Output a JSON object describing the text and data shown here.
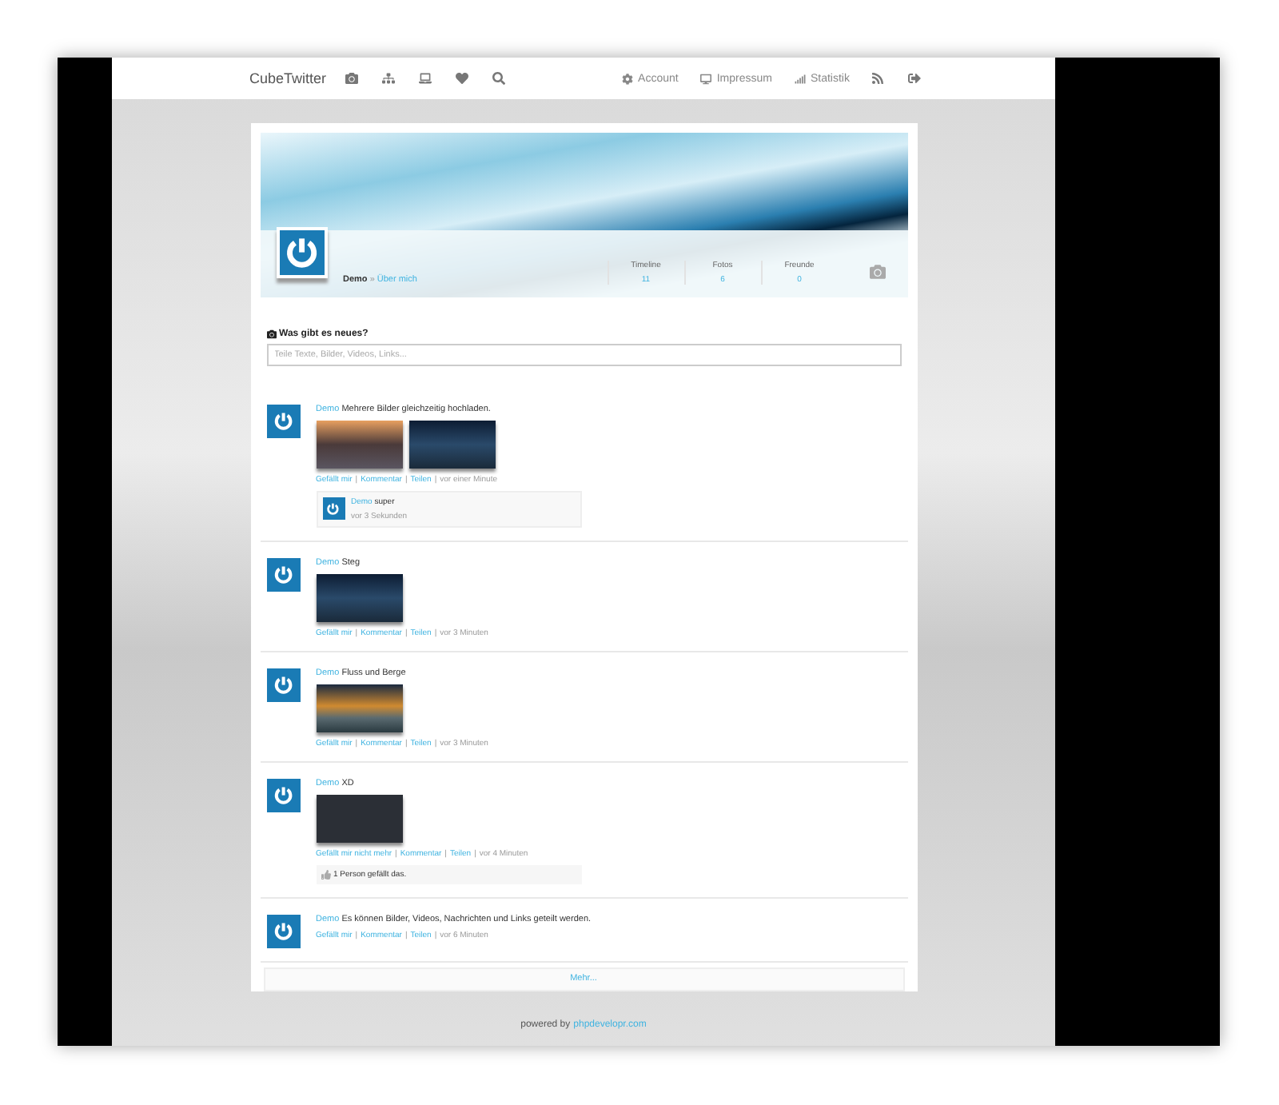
{
  "navbar": {
    "brand": "CubeTwitter",
    "links": [
      {
        "label": "Account"
      },
      {
        "label": "Impressum"
      },
      {
        "label": "Statistik"
      }
    ]
  },
  "profile": {
    "name": "Demo",
    "separator": "»",
    "about_link": "Über mich",
    "stats": [
      {
        "label": "Timeline",
        "value": "11"
      },
      {
        "label": "Fotos",
        "value": "6"
      },
      {
        "label": "Freunde",
        "value": "0"
      }
    ]
  },
  "composer": {
    "title": "Was gibt es neues?",
    "placeholder": "Teile Texte, Bilder, Videos, Links..."
  },
  "posts": [
    {
      "author": "Demo",
      "text": "Mehrere Bilder gleichzeitig hochladen.",
      "images": [
        {
          "kind": "road"
        },
        {
          "kind": "pier"
        }
      ],
      "actions": [
        "Gefällt mir",
        "|",
        "Kommentar",
        "|",
        "Teilen",
        "|"
      ],
      "time": "vor einer Minute",
      "comment": {
        "author": "Demo",
        "text": "super",
        "time": "vor 3 Sekunden"
      }
    },
    {
      "author": "Demo",
      "text": "Steg",
      "images": [
        {
          "kind": "pier"
        }
      ],
      "actions": [
        "Gefällt mir",
        "|",
        "Kommentar",
        "|",
        "Teilen",
        "|"
      ],
      "time": "vor 3 Minuten"
    },
    {
      "author": "Demo",
      "text": "Fluss und Berge",
      "images": [
        {
          "kind": "mountains"
        }
      ],
      "actions": [
        "Gefällt mir",
        "|",
        "Kommentar",
        "|",
        "Teilen",
        "|"
      ],
      "time": "vor 3 Minuten"
    },
    {
      "author": "Demo",
      "text": "XD",
      "images": [
        {
          "kind": "code"
        }
      ],
      "actions": [
        "Gefällt mir nicht mehr",
        "|",
        "Kommentar",
        "|",
        "Teilen",
        "|"
      ],
      "time": "vor 4 Minuten",
      "likes": "1 Person gefällt das."
    },
    {
      "author": "Demo",
      "text": "Es können Bilder, Videos, Nachrichten und Links geteilt werden.",
      "actions": [
        "Gefällt mir",
        "|",
        "Kommentar",
        "|",
        "Teilen",
        "|"
      ],
      "time": "vor 6 Minuten"
    }
  ],
  "more_button": "Mehr...",
  "footer": {
    "text": "powered by",
    "link": "phpdevelopr.com"
  }
}
